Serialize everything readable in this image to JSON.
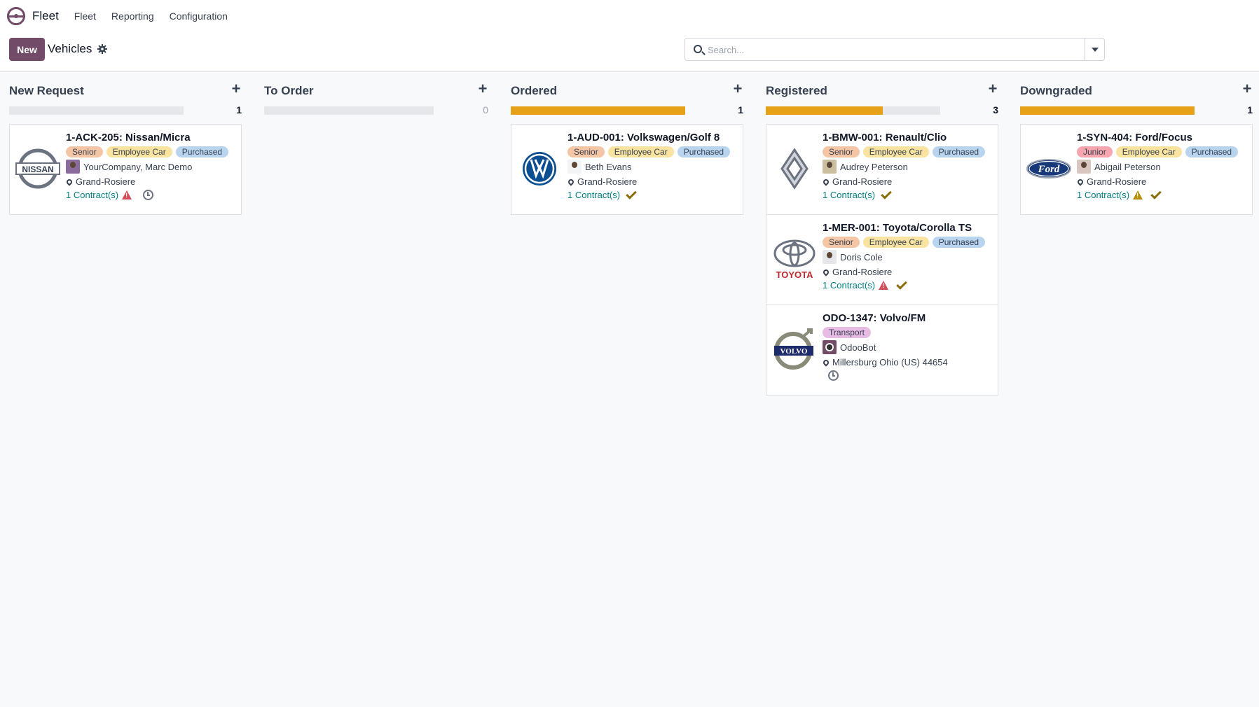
{
  "nav": {
    "app_name": "Fleet",
    "menu": [
      "Fleet",
      "Reporting",
      "Configuration"
    ]
  },
  "control": {
    "new_label": "New",
    "breadcrumb": "Vehicles",
    "search_placeholder": "Search..."
  },
  "colors": {
    "brand": "#714b67",
    "progress": "#e6a118",
    "link": "#017e84"
  },
  "columns": [
    {
      "title": "New Request",
      "count": "1",
      "progress": 0,
      "cards": [
        {
          "title": "1-ACK-205: Nissan/Micra",
          "logo": "nissan-logo",
          "tags": [
            "Senior",
            "Employee Car",
            "Purchased"
          ],
          "driver": "YourCompany, Marc Demo",
          "location": "Grand-Rosiere",
          "contracts": "1 Contract(s)",
          "status_icons": [
            "warning-icon",
            "clock-icon"
          ]
        }
      ]
    },
    {
      "title": "To Order",
      "count": "0",
      "progress": 0,
      "cards": []
    },
    {
      "title": "Ordered",
      "count": "1",
      "progress": 1,
      "cards": [
        {
          "title": "1-AUD-001: Volkswagen/Golf 8",
          "logo": "volkswagen-logo",
          "tags": [
            "Senior",
            "Employee Car",
            "Purchased"
          ],
          "driver": "Beth Evans",
          "location": "Grand-Rosiere",
          "contracts": "1 Contract(s)",
          "status_icons": [
            "check-icon"
          ]
        }
      ]
    },
    {
      "title": "Registered",
      "count": "3",
      "progress": 0.67,
      "cards": [
        {
          "title": "1-BMW-001: Renault/Clio",
          "logo": "renault-logo",
          "tags": [
            "Senior",
            "Employee Car",
            "Purchased"
          ],
          "driver": "Audrey Peterson",
          "location": "Grand-Rosiere",
          "contracts": "1 Contract(s)",
          "status_icons": [
            "check-icon"
          ]
        },
        {
          "title": "1-MER-001: Toyota/Corolla TS",
          "logo": "toyota-logo",
          "logo_text": "TOYOTA",
          "tags": [
            "Senior",
            "Employee Car",
            "Purchased"
          ],
          "driver": "Doris Cole",
          "location": "Grand-Rosiere",
          "contracts": "1 Contract(s)",
          "status_icons": [
            "warning-icon",
            "check-icon"
          ]
        },
        {
          "title": "ODO-1347: Volvo/FM",
          "logo": "volvo-logo",
          "logo_text": "VOLVO",
          "tags": [
            "Transport"
          ],
          "driver": "OdooBot",
          "location": "Millersburg Ohio (US) 44654",
          "contracts": "",
          "status_icons": [
            "clock-icon"
          ]
        }
      ]
    },
    {
      "title": "Downgraded",
      "count": "1",
      "progress": 1,
      "cards": [
        {
          "title": "1-SYN-404: Ford/Focus",
          "logo": "ford-logo",
          "logo_text": "Ford",
          "tags": [
            "Junior",
            "Employee Car",
            "Purchased"
          ],
          "driver": "Abigail Peterson",
          "location": "Grand-Rosiere",
          "contracts": "1 Contract(s)",
          "status_icons": [
            "warning-icon",
            "check-icon"
          ]
        }
      ]
    }
  ]
}
